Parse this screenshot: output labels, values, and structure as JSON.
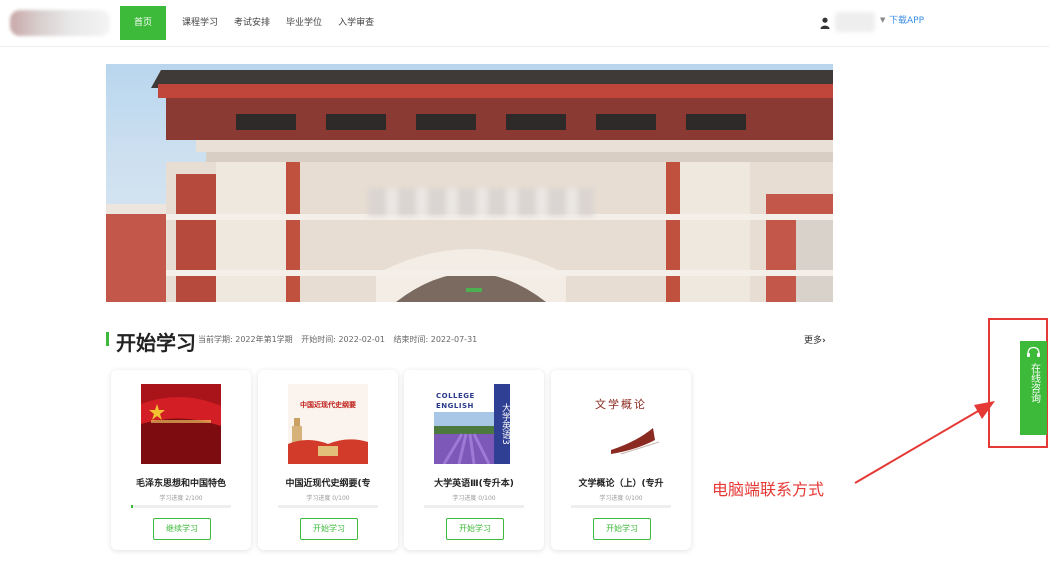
{
  "header": {
    "nav": [
      "首页",
      "课程学习",
      "考试安排",
      "毕业学位",
      "入学审查"
    ],
    "download_label": "下载APP"
  },
  "section": {
    "title": "开始学习",
    "term_label": "当前学期: 2022年第1学期",
    "start_label": "开始时间: 2022-02-01",
    "end_label": "结束时间: 2022-07-31",
    "more_label": "更多"
  },
  "courses": [
    {
      "title": "毛泽东思想和中国特色",
      "progress_text": "学习进度 2/100",
      "progress": 0.02,
      "button": "继续学习"
    },
    {
      "title": "中国近现代史纲要(专",
      "progress_text": "学习进度 0/100",
      "progress": 0,
      "button": "开始学习",
      "cover_text": "中国近现代史纲要"
    },
    {
      "title": "大学英语Ⅲ(专升本)",
      "progress_text": "学习进度 0/100",
      "progress": 0,
      "button": "开始学习",
      "cover_text": [
        "COLLEGE",
        "ENGLISH",
        "大学英语3"
      ]
    },
    {
      "title": "文学概论（上）(专升",
      "progress_text": "学习进度 0/100",
      "progress": 0,
      "button": "开始学习",
      "cover_text": "文学概论"
    }
  ],
  "annotation": {
    "text": "电脑端联系方式"
  },
  "consult": {
    "label": "在线咨询"
  },
  "colors": {
    "accent": "#3dba3a",
    "annotation": "#e53935",
    "link": "#3a8ee6"
  }
}
